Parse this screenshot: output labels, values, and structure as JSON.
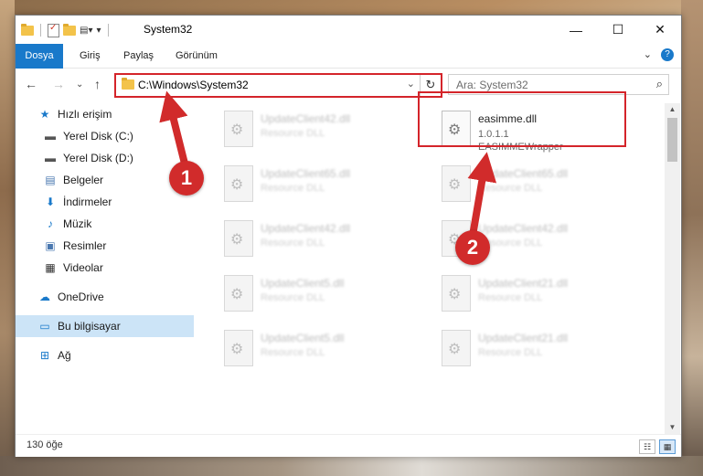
{
  "window": {
    "title": "System32",
    "controls": {
      "minimize": "—",
      "maximize": "☐",
      "close": "✕"
    }
  },
  "ribbon": {
    "tabs": [
      "Dosya",
      "Giriş",
      "Paylaş",
      "Görünüm"
    ],
    "expand_icon": "⌄",
    "help_icon": "?"
  },
  "nav": {
    "back": "←",
    "forward": "→",
    "recent": "⌄",
    "up": "↑"
  },
  "address": {
    "path": "C:\\Windows\\System32",
    "dropdown": "⌄",
    "refresh": "↻"
  },
  "search": {
    "placeholder": "Ara: System32",
    "icon": "⌕"
  },
  "sidebar": {
    "items": [
      {
        "label": "Hızlı erişim",
        "icon": "star-icon",
        "glyph": "★",
        "color": "#1979ca"
      },
      {
        "label": "Yerel Disk (C:)",
        "icon": "drive-icon",
        "glyph": "▬",
        "color": "#555555"
      },
      {
        "label": "Yerel Disk (D:)",
        "icon": "drive-icon",
        "glyph": "▬",
        "color": "#555555"
      },
      {
        "label": "Belgeler",
        "icon": "documents-icon",
        "glyph": "▤",
        "color": "#4a78b0"
      },
      {
        "label": "İndirmeler",
        "icon": "download-icon",
        "glyph": "⬇",
        "color": "#1979ca"
      },
      {
        "label": "Müzik",
        "icon": "music-icon",
        "glyph": "♪",
        "color": "#1979ca"
      },
      {
        "label": "Resimler",
        "icon": "pictures-icon",
        "glyph": "▣",
        "color": "#4a78b0"
      },
      {
        "label": "Videolar",
        "icon": "video-icon",
        "glyph": "▦",
        "color": "#333333"
      },
      {
        "label": "OneDrive",
        "icon": "cloud-icon",
        "glyph": "☁",
        "color": "#1979ca"
      },
      {
        "label": "Bu bilgisayar",
        "icon": "computer-icon",
        "glyph": "▭",
        "color": "#1979ca"
      },
      {
        "label": "Ağ",
        "icon": "network-icon",
        "glyph": "⊞",
        "color": "#1979ca"
      }
    ],
    "pin_glyph": "📌"
  },
  "files": [
    {
      "name": "UpdateClient42.dll",
      "desc": "Resource DLL"
    },
    {
      "name": "easimme.dll",
      "version": "1.0.1.1",
      "desc": "EASIMMEWrapper",
      "focused": true
    },
    {
      "name": "UpdateClient65.dll",
      "desc": "Resource DLL"
    },
    {
      "name": "UpdateClient65.dll",
      "desc": "Resource DLL"
    },
    {
      "name": "UpdateClient42.dll",
      "desc": "Resource DLL"
    },
    {
      "name": "UpdateClient42.dll",
      "desc": "Resource DLL"
    },
    {
      "name": "UpdateClient5.dll",
      "desc": "Resource DLL"
    },
    {
      "name": "UpdateClient21.dll",
      "desc": "Resource DLL"
    },
    {
      "name": "UpdateClient5.dll",
      "desc": "Resource DLL"
    },
    {
      "name": "UpdateClient21.dll",
      "desc": "Resource DLL"
    }
  ],
  "status": {
    "count": "130 öğe",
    "view_details": "☷",
    "view_tiles": "▦"
  },
  "annotations": {
    "step1": "1",
    "step2": "2",
    "color": "#d12b2b"
  }
}
